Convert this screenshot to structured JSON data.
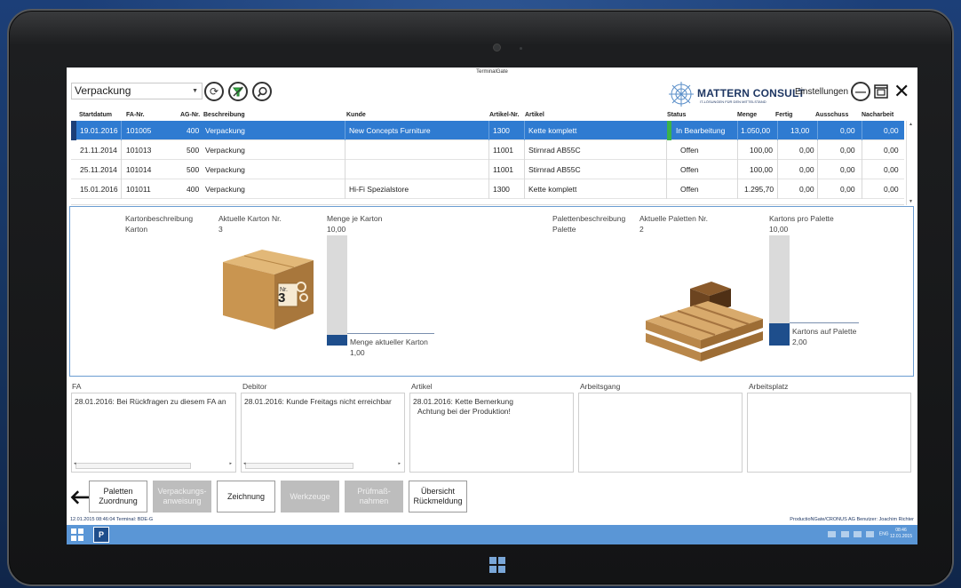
{
  "window": {
    "title": "TerminalGate"
  },
  "toolbar": {
    "area_value": "Verpackung",
    "settings_label": "Einstellungen",
    "brand_name": "MATTERN CONSULT",
    "brand_tagline": "IT-LÖSUNGEN FÜR DEN MITTELSTAND",
    "icons": [
      "refresh-icon",
      "filter-icon",
      "search-icon",
      "minimize-icon",
      "restore-icon",
      "close-icon"
    ]
  },
  "grid": {
    "headers": [
      "Startdatum",
      "FA-Nr.",
      "AG-Nr.",
      "Beschreibung",
      "Kunde",
      "Artikel-Nr.",
      "Artikel",
      "Status",
      "Menge",
      "Fertig",
      "Ausschuss",
      "Nacharbeit"
    ],
    "rows": [
      {
        "startdatum": "19.01.2016",
        "fa_nr": "101005",
        "ag_nr": "400",
        "beschreibung": "Verpackung",
        "kunde": "New Concepts Furniture",
        "artikel_nr": "1300",
        "artikel": "Kette komplett",
        "status": "In Bearbeitung",
        "menge": "1.050,00",
        "fertig": "13,00",
        "ausschuss": "0,00",
        "nacharbeit": "0,00"
      },
      {
        "startdatum": "21.11.2014",
        "fa_nr": "101013",
        "ag_nr": "500",
        "beschreibung": "Verpackung",
        "kunde": "",
        "artikel_nr": "11001",
        "artikel": "Stirnrad AB55C",
        "status": "Offen",
        "menge": "100,00",
        "fertig": "0,00",
        "ausschuss": "0,00",
        "nacharbeit": "0,00"
      },
      {
        "startdatum": "25.11.2014",
        "fa_nr": "101014",
        "ag_nr": "500",
        "beschreibung": "Verpackung",
        "kunde": "",
        "artikel_nr": "11001",
        "artikel": "Stirnrad AB55C",
        "status": "Offen",
        "menge": "100,00",
        "fertig": "0,00",
        "ausschuss": "0,00",
        "nacharbeit": "0,00"
      },
      {
        "startdatum": "15.01.2016",
        "fa_nr": "101011",
        "ag_nr": "400",
        "beschreibung": "Verpackung",
        "kunde": "Hi-Fi Spezialstore",
        "artikel_nr": "1300",
        "artikel": "Kette komplett",
        "status": "Offen",
        "menge": "1.295,70",
        "fertig": "0,00",
        "ausschuss": "0,00",
        "nacharbeit": "0,00"
      }
    ]
  },
  "packing": {
    "karton_desc_label": "Kartonbeschreibung",
    "karton_desc_value": "Karton",
    "karton_nr_label": "Aktuelle Karton Nr.",
    "karton_nr_value": "3",
    "box_label_nr": "Nr.",
    "box_label_value": "3",
    "menge_je_karton_label": "Menge je Karton",
    "menge_je_karton_value": "10,00",
    "menge_aktuell_label": "Menge aktueller Karton",
    "menge_aktuell_value": "1,00",
    "menge_fill": 0.1,
    "paletten_desc_label": "Palettenbeschreibung",
    "paletten_desc_value": "Palette",
    "paletten_nr_label": "Aktuelle Paletten Nr.",
    "paletten_nr_value": "2",
    "kartons_pro_palette_label": "Kartons pro Palette",
    "kartons_pro_palette_value": "10,00",
    "kartons_auf_palette_label": "Kartons auf Palette",
    "kartons_auf_palette_value": "2,00",
    "palette_fill": 0.2,
    "bar_color": "#1e4e8c"
  },
  "notes": [
    {
      "header": "FA",
      "text": "28.01.2016: Bei Rückfragen zu diesem FA an",
      "extra": ""
    },
    {
      "header": "Debitor",
      "text": "28.01.2016: Kunde Freitags nicht erreichbar",
      "extra": ""
    },
    {
      "header": "Artikel",
      "text": "28.01.2016: Kette Bemerkung",
      "extra": "Achtung bei der Produktion!"
    },
    {
      "header": "Arbeitsgang",
      "text": "",
      "extra": ""
    },
    {
      "header": "Arbeitsplatz",
      "text": "",
      "extra": ""
    }
  ],
  "actions": {
    "back_icon": "back-arrow-icon",
    "buttons": [
      {
        "line1": "Paletten",
        "line2": "Zuordnung",
        "enabled": true
      },
      {
        "line1": "Verpackungs-",
        "line2": "anweisung",
        "enabled": false
      },
      {
        "line1": "Zeichnung",
        "line2": "",
        "enabled": true
      },
      {
        "line1": "Werkzeuge",
        "line2": "",
        "enabled": false
      },
      {
        "line1": "Prüfmaß-",
        "line2": "nahmen",
        "enabled": false
      },
      {
        "line1": "Übersicht",
        "line2": "Rückmeldung",
        "enabled": true
      }
    ]
  },
  "status": {
    "left": "12.01.2015 08:46:04  Terminal: BDE-G",
    "right": "ProductioNGate/CRONUS AG  Benutzer: Joachim Richter"
  },
  "taskbar": {
    "lang": "ENG",
    "time": "08:46",
    "date": "12.01.2015",
    "accent": "#5a96d6"
  }
}
